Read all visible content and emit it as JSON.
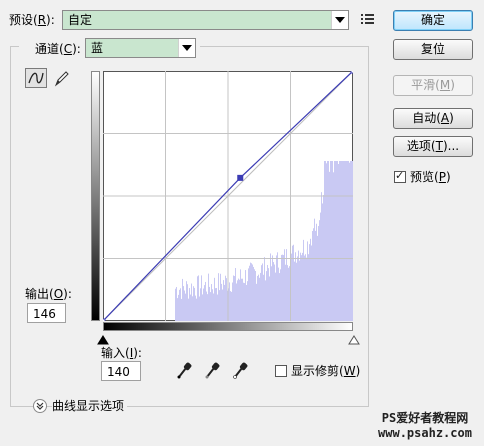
{
  "preset": {
    "label": "预设",
    "key": "R",
    "value": "自定"
  },
  "channel": {
    "label": "通道",
    "key": "C",
    "value": "蓝"
  },
  "buttons": {
    "ok": {
      "label": "确定"
    },
    "reset": {
      "label": "复位"
    },
    "smooth": {
      "label": "平滑",
      "key": "M"
    },
    "auto": {
      "label": "自动",
      "key": "A"
    },
    "options": {
      "label": "选项",
      "key": "T",
      "suffix": "..."
    }
  },
  "preview": {
    "label": "预览",
    "key": "P",
    "checked": true
  },
  "output": {
    "label": "输出",
    "key": "O",
    "value": "146"
  },
  "input": {
    "label": "输入",
    "key": "I",
    "value": "140"
  },
  "show_clipping": {
    "label": "显示修剪",
    "key": "W",
    "checked": false
  },
  "curve_display": {
    "label": "曲线显示选项"
  },
  "watermark": {
    "text": "PS爱好者教程网",
    "url": "www.psahz.com"
  },
  "curve": {
    "points": [
      [
        0,
        0
      ],
      [
        140,
        146
      ],
      [
        255,
        255
      ]
    ],
    "channel_color": "#3c3cb4",
    "histogram_color": "#c9c9f3"
  }
}
